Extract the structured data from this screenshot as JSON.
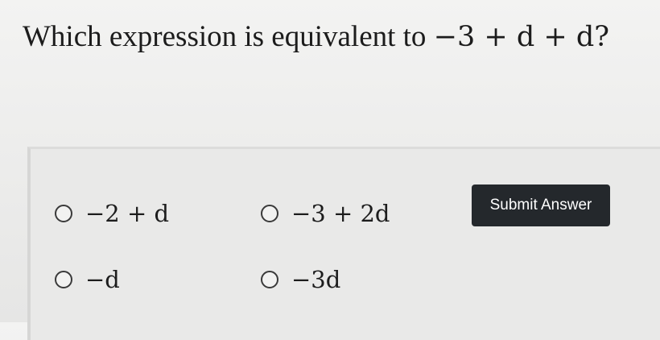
{
  "question": {
    "prefix": "Which expression is equivalent to ",
    "expression": "−3 + d + d",
    "suffix": "?"
  },
  "options": [
    {
      "label": "−2 + d"
    },
    {
      "label": "−3 + 2d"
    },
    {
      "label": "−d"
    },
    {
      "label": "−3d"
    }
  ],
  "submit": {
    "label": "Submit Answer"
  },
  "colors": {
    "button_bg": "#24282c",
    "button_text": "#ffffff"
  }
}
